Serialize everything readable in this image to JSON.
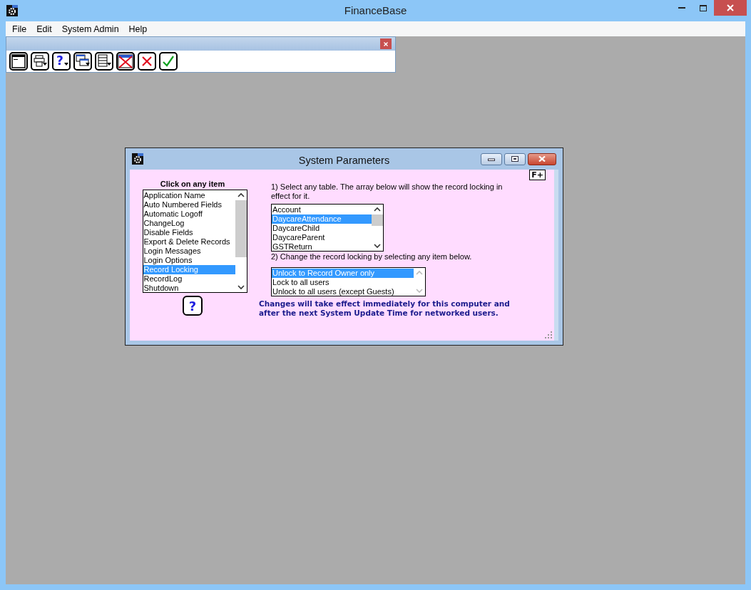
{
  "window": {
    "title": "FinanceBase"
  },
  "toolbar": {
    "help_glyph": "?"
  },
  "menu": [
    {
      "label": "File"
    },
    {
      "label": "Edit"
    },
    {
      "label": "System Admin"
    },
    {
      "label": "Help"
    }
  ],
  "dialog": {
    "title": "System Parameters",
    "corner_button": "F+",
    "item_heading": "Click on any item",
    "items": [
      {
        "label": "Application Name",
        "selected": false
      },
      {
        "label": "Auto Numbered Fields",
        "selected": false
      },
      {
        "label": "Automatic Logoff",
        "selected": false
      },
      {
        "label": "ChangeLog",
        "selected": false
      },
      {
        "label": "Disable Fields",
        "selected": false
      },
      {
        "label": "Export & Delete Records",
        "selected": false
      },
      {
        "label": "Login Messages",
        "selected": false
      },
      {
        "label": "Login Options",
        "selected": false
      },
      {
        "label": "Record Locking",
        "selected": true
      },
      {
        "label": "RecordLog",
        "selected": false
      },
      {
        "label": "Shutdown",
        "selected": false
      }
    ],
    "help_button": "?",
    "step1": "1) Select any table. The array below will show the record locking in effect for it.",
    "tables": [
      {
        "label": "Account",
        "selected": false
      },
      {
        "label": "DaycareAttendance",
        "selected": true
      },
      {
        "label": "DaycareChild",
        "selected": false
      },
      {
        "label": "DaycareParent",
        "selected": false
      },
      {
        "label": "GSTReturn",
        "selected": false
      }
    ],
    "step2": "2) Change the record locking by selecting any item below.",
    "locking_options": [
      {
        "label": "Unlock to Record Owner only",
        "selected": true
      },
      {
        "label": "Lock to all users",
        "selected": false
      },
      {
        "label": "Unlock to all users (except Guests)",
        "selected": false
      }
    ],
    "note": "Changes will take effect immediately for this computer and after the next System Update Time for networked users."
  }
}
